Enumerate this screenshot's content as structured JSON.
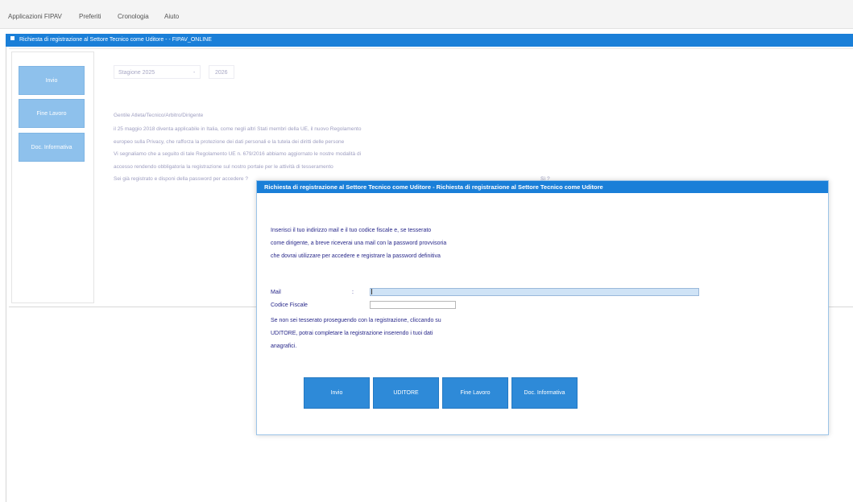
{
  "menubar": {
    "items": [
      "Applicazioni FIPAV",
      "Preferiti",
      "Cronologia",
      "Aiuto"
    ]
  },
  "window": {
    "title": "Richiesta di registrazione al Settore Tecnico come Uditore - - FIPAV_ONLINE"
  },
  "sidebar": {
    "buttons": [
      "Invio",
      "Fine Lavoro",
      "Doc. Informativa"
    ]
  },
  "season": {
    "label": "Stagione 2025",
    "separator": "-",
    "end": "2026"
  },
  "background_text": [
    "Gentile Atleta/Tecnico/Arbitro/Dirigente",
    "il 25 maggio 2018 diventa applicabile in Italia, come negli altri Stati membri della UE, il nuovo Regolamento",
    "europeo sulla Privacy, che rafforza la protezione dei dati personali e la tutela dei diritti delle persone",
    "Vi segnaliamo che a seguito di tale Regolamento UE n. 679/2016 abbiamo aggiornato le nostre modalità di",
    "accesso rendendo obbligatoria la registrazione sul nostro portale per le attività di tesseramento",
    "Sei già registrato e disponi della password per accedere ?"
  ],
  "background_short": "Sì   ?",
  "modal": {
    "title": "Richiesta di registrazione al Settore Tecnico come Uditore - Richiesta di registrazione al Settore Tecnico come Uditore",
    "intro": [
      "Inserisci il tuo indirizzo mail e il tuo codice fiscale e, se tesserato",
      "come dirigente, a breve riceverai una mail con la password provvisoria",
      "che dovrai utilizzare per accedere e registrare la password definitiva"
    ],
    "mail_label": "Mail",
    "mail_colon": ":",
    "mail_value": "",
    "cf_label": "Codice Fiscale",
    "cf_value": "",
    "note": [
      "Se non sei tesserato proseguendo con la registrazione, cliccando su",
      "UDITORE, potrai completare la registrazione inserendo i tuoi dati",
      "anagrafici."
    ],
    "buttons": [
      "Invio",
      "UDITORE",
      "Fine Lavoro",
      "Doc. Informativa"
    ]
  },
  "colors": {
    "accent": "#1a7fd8",
    "button": "#2e8ad8",
    "sidebar_button": "#8ec1ec",
    "text": "#28288a"
  }
}
